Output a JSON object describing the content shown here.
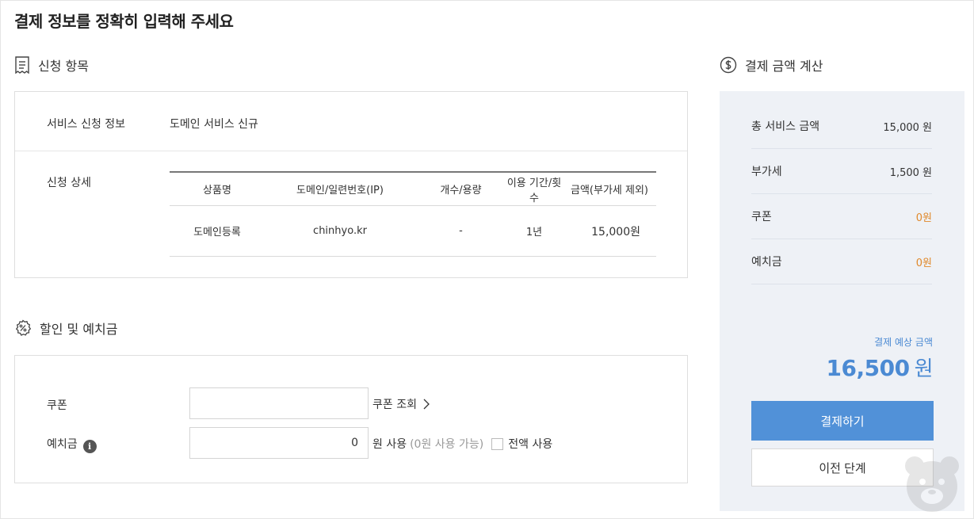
{
  "page_title": "결제 정보를 정확히 입력해 주세요",
  "apply_section": {
    "title": "신청 항목",
    "service_info_label": "서비스 신청 정보",
    "service_info_value": "도메인 서비스 신규",
    "detail_label": "신청 상세",
    "table": {
      "headers": [
        "상품명",
        "도메인/일련번호(IP)",
        "개수/용량",
        "이용 기간/횟수",
        "금액(부가세 제외)"
      ],
      "rows": [
        [
          "도메인등록",
          "chinhyo.kr",
          "-",
          "1년",
          "15,000원"
        ]
      ]
    }
  },
  "discount_section": {
    "title": "할인 및 예치금",
    "coupon_label": "쿠폰",
    "coupon_value": "",
    "coupon_lookup": "쿠폰 조회",
    "deposit_label": "예치금",
    "deposit_info_icon": "i",
    "deposit_value": "0",
    "deposit_unit": "원 사용",
    "deposit_available": "(0원 사용 가능)",
    "use_all_label": "전액 사용"
  },
  "calc_section": {
    "title": "결제 금액 계산",
    "rows": [
      {
        "label": "총 서비스 금액",
        "value": "15,000 원"
      },
      {
        "label": "부가세",
        "value": "1,500 원"
      },
      {
        "label": "쿠폰",
        "value": "0원"
      },
      {
        "label": "예치금",
        "value": "0원"
      }
    ],
    "expected_label": "결제 예상 금액",
    "expected_amount": "16,500",
    "expected_unit": "원",
    "pay_button": "결제하기",
    "prev_button": "이전 단계"
  },
  "colors": {
    "accent": "#5191d8",
    "amount_blue": "#4b8ad3",
    "discount_orange": "#e0892b",
    "panel_bg": "#eef1f6"
  }
}
